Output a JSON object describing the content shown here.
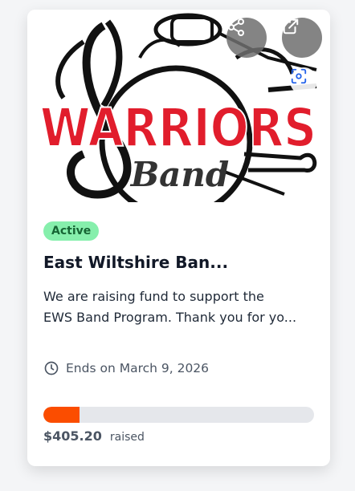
{
  "hero": {
    "logo_text": "WARRIORS",
    "logo_subtext": "Band",
    "logo_color": "#e11d2c"
  },
  "actions": {
    "share_icon": "share-icon",
    "open_icon": "external-link-icon",
    "scan_icon": "scan-icon"
  },
  "campaign": {
    "status": "Active",
    "status_color": "#86efac",
    "title": "East Wiltshire Ban...",
    "description_lines": [
      "We are raising fund to support the",
      "EWS Band Program. Thank you for yo..."
    ],
    "ends_label": "Ends on March 9, 2026",
    "progress_fraction": 0.135,
    "progress_color": "#fb4d00",
    "raised_amount": "$405.20",
    "raised_label": "raised"
  }
}
